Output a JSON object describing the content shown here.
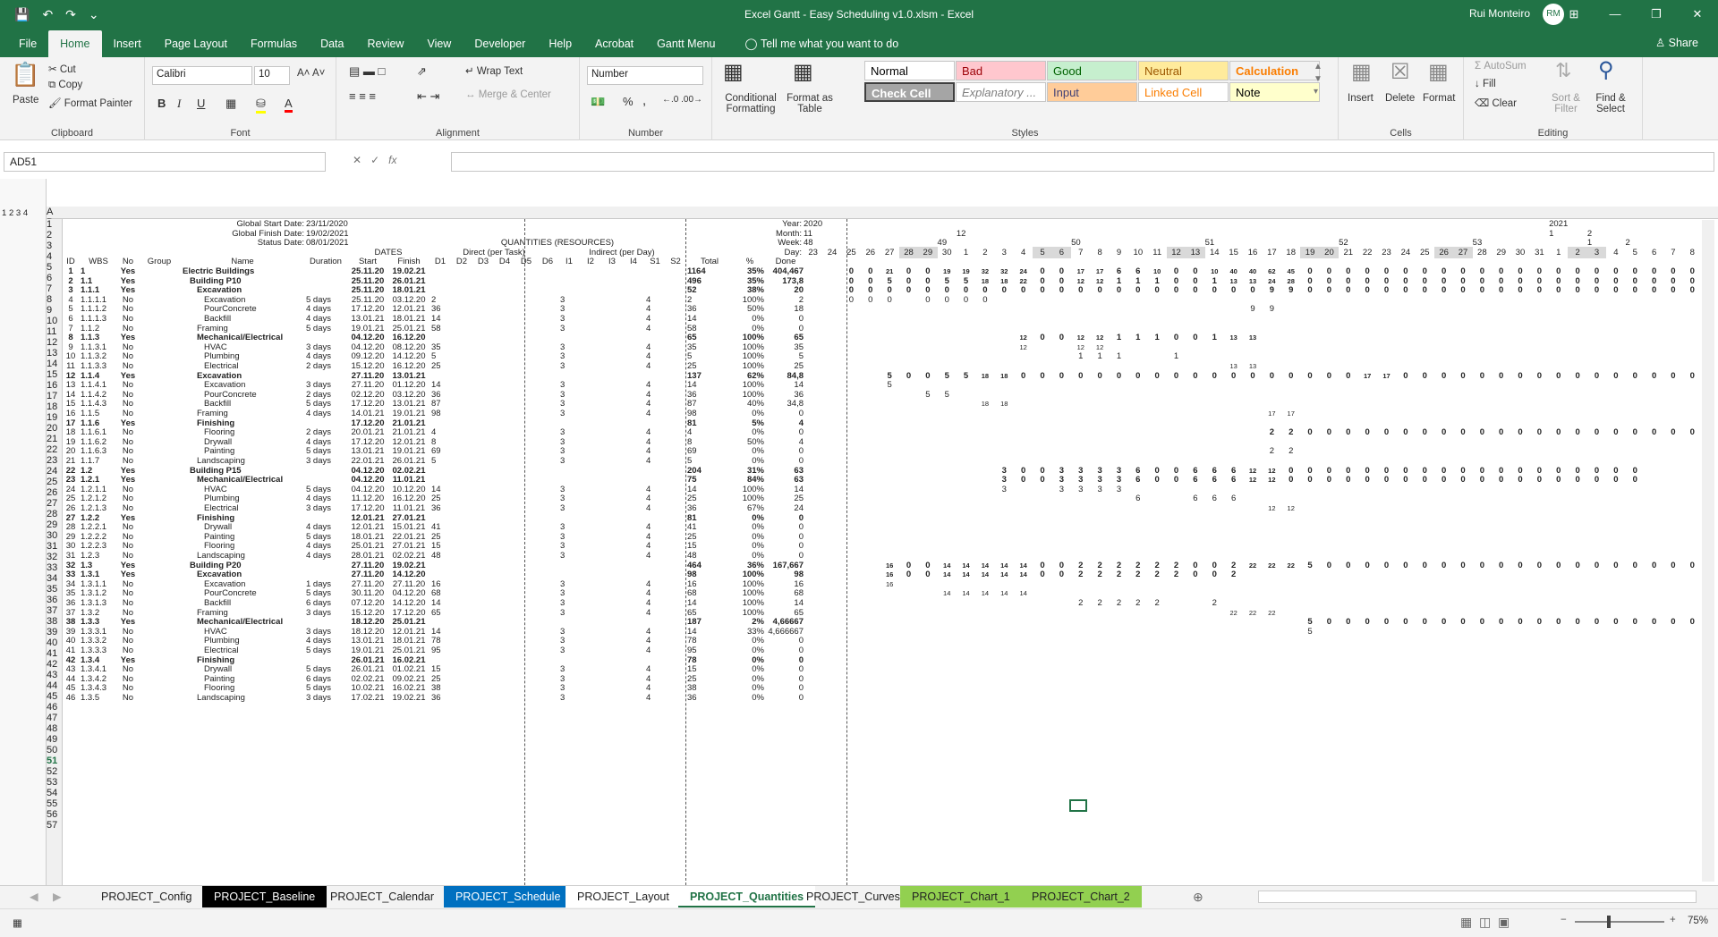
{
  "app": {
    "title": "Excel Gantt - Easy Scheduling v1.0.xlsm  -  Excel",
    "user": "Rui Monteiro",
    "user_initials": "RM",
    "share": "Share",
    "win_min": "—",
    "win_max": "❐",
    "win_close": "✕",
    "ribbon_display": "⊞"
  },
  "ribbon_tabs": [
    "File",
    "Home",
    "Insert",
    "Page Layout",
    "Formulas",
    "Data",
    "Review",
    "View",
    "Developer",
    "Help",
    "Acrobat",
    "Gantt Menu"
  ],
  "tell_me": "Tell me what you want to do",
  "clipboard": {
    "paste": "Paste",
    "cut": "Cut",
    "copy": "Copy",
    "format_painter": "Format Painter",
    "label": "Clipboard"
  },
  "font": {
    "name": "Calibri",
    "size": "10",
    "label": "Font",
    "bold": "B",
    "italic": "I",
    "underline": "U"
  },
  "alignment": {
    "wrap": "Wrap Text",
    "merge": "Merge & Center",
    "label": "Alignment"
  },
  "number": {
    "format": "Number",
    "label": "Number",
    "percent": "%",
    "comma": ","
  },
  "styles": {
    "conditional": "Conditional Formatting",
    "format_table": "Format as Table",
    "label": "Styles",
    "items": [
      {
        "name": "Normal",
        "bg": "#ffffff",
        "fg": "#000000"
      },
      {
        "name": "Bad",
        "bg": "#ffc7ce",
        "fg": "#9c0006"
      },
      {
        "name": "Good",
        "bg": "#c6efce",
        "fg": "#006100"
      },
      {
        "name": "Neutral",
        "bg": "#ffeb9c",
        "fg": "#9c5700"
      },
      {
        "name": "Calculation",
        "bg": "#f2f2f2",
        "fg": "#fa7d00"
      },
      {
        "name": "Check Cell",
        "bg": "#a5a5a5",
        "fg": "#ffffff"
      },
      {
        "name": "Explanatory ...",
        "bg": "#ffffff",
        "fg": "#7f7f7f"
      },
      {
        "name": "Input",
        "bg": "#ffcc99",
        "fg": "#3f3f76"
      },
      {
        "name": "Linked Cell",
        "bg": "#ffffff",
        "fg": "#fa7d00"
      },
      {
        "name": "Note",
        "bg": "#ffffcc",
        "fg": "#000000"
      }
    ]
  },
  "cells": {
    "insert": "Insert",
    "delete": "Delete",
    "format": "Format",
    "label": "Cells"
  },
  "editing": {
    "autosum": "AutoSum",
    "fill": "Fill",
    "clear": "Clear",
    "sort": "Sort & Filter",
    "find": "Find & Select",
    "label": "Editing"
  },
  "formula_bar": {
    "name_box": "AD51",
    "fx": "fx",
    "value": ""
  },
  "header_info": {
    "start_label": "Global Start Date:",
    "start": "23/11/2020",
    "finish_label": "Global Finish Date:",
    "finish": "19/02/2021",
    "status_label": "Status Date:",
    "status": "08/01/2021",
    "dates": "DATES",
    "quantities": "QUANTITIES (RESOURCES)",
    "direct": "Direct (per Task)",
    "indirect": "Indirect (per Day)"
  },
  "gantt_labels": {
    "year": "Year:",
    "month": "Month:",
    "week": "Week:",
    "day": "Day:"
  },
  "years": [
    "2020",
    "2021"
  ],
  "months": [
    "11",
    "12",
    "1",
    "2"
  ],
  "weeks": [
    "48",
    "49",
    "50",
    "51",
    "52",
    "53",
    "1",
    "2"
  ],
  "days": [
    "23",
    "24",
    "25",
    "26",
    "27",
    "28",
    "29",
    "30",
    "1",
    "2",
    "3",
    "4",
    "5",
    "6",
    "7",
    "8",
    "9",
    "10",
    "11",
    "12",
    "13",
    "14",
    "15",
    "16",
    "17",
    "18",
    "19",
    "20",
    "21",
    "22",
    "23",
    "24",
    "25",
    "26",
    "27",
    "28",
    "29",
    "30",
    "31",
    "1",
    "2",
    "3",
    "4",
    "5",
    "6",
    "7",
    "8"
  ],
  "col_letters": [
    "A",
    "B",
    "C",
    "D",
    "E",
    "F",
    "G",
    "H",
    "I",
    "J",
    "K",
    "L",
    "M",
    "N",
    "O",
    "P",
    "Q",
    "R",
    "S",
    "T",
    "U",
    "V",
    "W",
    "X",
    "Y",
    "Z",
    "AA",
    "AB",
    "AC",
    "AD",
    "AE",
    "AF",
    "AG",
    "AH",
    "AI",
    "AJ",
    "AK",
    "AL",
    "AM",
    "AN",
    "AO",
    "AP",
    "AQ",
    "AR",
    "AS",
    "AT",
    "AU",
    "AV",
    "AW",
    "AX",
    "AY",
    "AZ",
    "BA",
    "BB",
    "BC",
    "BD",
    "BE",
    "BF",
    "BG",
    "BH",
    "BI",
    "BJ",
    "BK",
    "BL",
    "BM",
    "BN",
    "BO",
    "BP",
    "BQ",
    "BR"
  ],
  "col_headers": [
    "ID",
    "WBS",
    "No",
    "Group",
    "Name",
    "Duration",
    "Start",
    "Finish",
    "D1",
    "D2",
    "D3",
    "D4",
    "D5",
    "D6",
    "I1",
    "I2",
    "I3",
    "I4",
    "S1",
    "S2",
    "Total",
    "%",
    "Done"
  ],
  "outline_levels": [
    "1",
    "2",
    "3",
    "4"
  ],
  "rows": [
    [
      "1",
      "1",
      "Yes",
      "Electric Buildings",
      "",
      "25.11.20",
      "19.02.21",
      "",
      "1164",
      "35%",
      "404,467"
    ],
    [
      "2",
      "1.1",
      "Yes",
      "Building P10",
      "",
      "25.11.20",
      "26.01.21",
      "",
      "496",
      "35%",
      "173,8"
    ],
    [
      "3",
      "1.1.1",
      "Yes",
      "Excavation",
      "",
      "25.11.20",
      "18.01.21",
      "",
      "52",
      "38%",
      "20"
    ],
    [
      "4",
      "1.1.1.1",
      "No",
      "Excavation",
      "5 days",
      "25.11.20",
      "03.12.20",
      "2",
      "2",
      "100%",
      "2"
    ],
    [
      "5",
      "1.1.1.2",
      "No",
      "PourConcrete",
      "4 days",
      "17.12.20",
      "12.01.21",
      "36",
      "36",
      "50%",
      "18"
    ],
    [
      "6",
      "1.1.1.3",
      "No",
      "Backfill",
      "4 days",
      "13.01.21",
      "18.01.21",
      "14",
      "14",
      "0%",
      "0"
    ],
    [
      "7",
      "1.1.2",
      "No",
      "Framing",
      "5 days",
      "19.01.21",
      "25.01.21",
      "58",
      "58",
      "0%",
      "0"
    ],
    [
      "8",
      "1.1.3",
      "Yes",
      "Mechanical/Electrical",
      "",
      "04.12.20",
      "16.12.20",
      "",
      "65",
      "100%",
      "65"
    ],
    [
      "9",
      "1.1.3.1",
      "No",
      "HVAC",
      "3 days",
      "04.12.20",
      "08.12.20",
      "35",
      "35",
      "100%",
      "35"
    ],
    [
      "10",
      "1.1.3.2",
      "No",
      "Plumbing",
      "4 days",
      "09.12.20",
      "14.12.20",
      "5",
      "5",
      "100%",
      "5"
    ],
    [
      "11",
      "1.1.3.3",
      "No",
      "Electrical",
      "2 days",
      "15.12.20",
      "16.12.20",
      "25",
      "25",
      "100%",
      "25"
    ],
    [
      "12",
      "1.1.4",
      "Yes",
      "Excavation",
      "",
      "27.11.20",
      "13.01.21",
      "",
      "137",
      "62%",
      "84,8"
    ],
    [
      "13",
      "1.1.4.1",
      "No",
      "Excavation",
      "3 days",
      "27.11.20",
      "01.12.20",
      "14",
      "14",
      "100%",
      "14"
    ],
    [
      "14",
      "1.1.4.2",
      "No",
      "PourConcrete",
      "2 days",
      "02.12.20",
      "03.12.20",
      "36",
      "36",
      "100%",
      "36"
    ],
    [
      "15",
      "1.1.4.3",
      "No",
      "Backfill",
      "5 days",
      "17.12.20",
      "13.01.21",
      "87",
      "87",
      "40%",
      "34,8"
    ],
    [
      "16",
      "1.1.5",
      "No",
      "Framing",
      "4 days",
      "14.01.21",
      "19.01.21",
      "98",
      "98",
      "0%",
      "0"
    ],
    [
      "17",
      "1.1.6",
      "Yes",
      "Finishing",
      "",
      "17.12.20",
      "21.01.21",
      "",
      "81",
      "5%",
      "4"
    ],
    [
      "18",
      "1.1.6.1",
      "No",
      "Flooring",
      "2 days",
      "20.01.21",
      "21.01.21",
      "4",
      "4",
      "0%",
      "0"
    ],
    [
      "19",
      "1.1.6.2",
      "No",
      "Drywall",
      "4 days",
      "17.12.20",
      "12.01.21",
      "8",
      "8",
      "50%",
      "4"
    ],
    [
      "20",
      "1.1.6.3",
      "No",
      "Painting",
      "5 days",
      "13.01.21",
      "19.01.21",
      "69",
      "69",
      "0%",
      "0"
    ],
    [
      "21",
      "1.1.7",
      "No",
      "Landscaping",
      "3 days",
      "22.01.21",
      "26.01.21",
      "5",
      "5",
      "0%",
      "0"
    ],
    [
      "22",
      "1.2",
      "Yes",
      "Building P15",
      "",
      "04.12.20",
      "02.02.21",
      "",
      "204",
      "31%",
      "63"
    ],
    [
      "23",
      "1.2.1",
      "Yes",
      "Mechanical/Electrical",
      "",
      "04.12.20",
      "11.01.21",
      "",
      "75",
      "84%",
      "63"
    ],
    [
      "24",
      "1.2.1.1",
      "No",
      "HVAC",
      "5 days",
      "04.12.20",
      "10.12.20",
      "14",
      "14",
      "100%",
      "14"
    ],
    [
      "25",
      "1.2.1.2",
      "No",
      "Plumbing",
      "4 days",
      "11.12.20",
      "16.12.20",
      "25",
      "25",
      "100%",
      "25"
    ],
    [
      "26",
      "1.2.1.3",
      "No",
      "Electrical",
      "3 days",
      "17.12.20",
      "11.01.21",
      "36",
      "36",
      "67%",
      "24"
    ],
    [
      "27",
      "1.2.2",
      "Yes",
      "Finishing",
      "",
      "12.01.21",
      "27.01.21",
      "",
      "81",
      "0%",
      "0"
    ],
    [
      "28",
      "1.2.2.1",
      "No",
      "Drywall",
      "4 days",
      "12.01.21",
      "15.01.21",
      "41",
      "41",
      "0%",
      "0"
    ],
    [
      "29",
      "1.2.2.2",
      "No",
      "Painting",
      "5 days",
      "18.01.21",
      "22.01.21",
      "25",
      "25",
      "0%",
      "0"
    ],
    [
      "30",
      "1.2.2.3",
      "No",
      "Flooring",
      "4 days",
      "25.01.21",
      "27.01.21",
      "15",
      "15",
      "0%",
      "0"
    ],
    [
      "31",
      "1.2.3",
      "No",
      "Landscaping",
      "4 days",
      "28.01.21",
      "02.02.21",
      "48",
      "48",
      "0%",
      "0"
    ],
    [
      "32",
      "1.3",
      "Yes",
      "Building P20",
      "",
      "27.11.20",
      "19.02.21",
      "",
      "464",
      "36%",
      "167,667"
    ],
    [
      "33",
      "1.3.1",
      "Yes",
      "Excavation",
      "",
      "27.11.20",
      "14.12.20",
      "",
      "98",
      "100%",
      "98"
    ],
    [
      "34",
      "1.3.1.1",
      "No",
      "Excavation",
      "1 days",
      "27.11.20",
      "27.11.20",
      "16",
      "16",
      "100%",
      "16"
    ],
    [
      "35",
      "1.3.1.2",
      "No",
      "PourConcrete",
      "5 days",
      "30.11.20",
      "04.12.20",
      "68",
      "68",
      "100%",
      "68"
    ],
    [
      "36",
      "1.3.1.3",
      "No",
      "Backfill",
      "6 days",
      "07.12.20",
      "14.12.20",
      "14",
      "14",
      "100%",
      "14"
    ],
    [
      "37",
      "1.3.2",
      "No",
      "Framing",
      "3 days",
      "15.12.20",
      "17.12.20",
      "65",
      "65",
      "100%",
      "65"
    ],
    [
      "38",
      "1.3.3",
      "Yes",
      "Mechanical/Electrical",
      "",
      "18.12.20",
      "25.01.21",
      "",
      "187",
      "2%",
      "4,66667"
    ],
    [
      "39",
      "1.3.3.1",
      "No",
      "HVAC",
      "3 days",
      "18.12.20",
      "12.01.21",
      "14",
      "14",
      "33%",
      "4,666667"
    ],
    [
      "40",
      "1.3.3.2",
      "No",
      "Plumbing",
      "4 days",
      "13.01.21",
      "18.01.21",
      "78",
      "78",
      "0%",
      "0"
    ],
    [
      "41",
      "1.3.3.3",
      "No",
      "Electrical",
      "5 days",
      "19.01.21",
      "25.01.21",
      "95",
      "95",
      "0%",
      "0"
    ],
    [
      "42",
      "1.3.4",
      "Yes",
      "Finishing",
      "",
      "26.01.21",
      "16.02.21",
      "",
      "78",
      "0%",
      "0"
    ],
    [
      "43",
      "1.3.4.1",
      "No",
      "Drywall",
      "5 days",
      "26.01.21",
      "01.02.21",
      "15",
      "15",
      "0%",
      "0"
    ],
    [
      "44",
      "1.3.4.2",
      "No",
      "Painting",
      "6 days",
      "02.02.21",
      "09.02.21",
      "25",
      "25",
      "0%",
      "0"
    ],
    [
      "45",
      "1.3.4.3",
      "No",
      "Flooring",
      "5 days",
      "10.02.21",
      "16.02.21",
      "38",
      "38",
      "0%",
      "0"
    ],
    [
      "46",
      "1.3.5",
      "No",
      "Landscaping",
      "3 days",
      "17.02.21",
      "19.02.21",
      "36",
      "36",
      "0%",
      "0"
    ]
  ],
  "indirect": {
    "i1": "3",
    "s1": "4"
  },
  "gantt_rows": {
    "6": [
      "0",
      "0",
      "21",
      "0",
      "0",
      "19",
      "19",
      "32",
      "32",
      "24",
      "0",
      "0",
      "17",
      "17",
      "6",
      "6",
      "10",
      "0",
      "0",
      "10",
      "40",
      "40",
      "62",
      "45",
      "0",
      "0",
      "0",
      "0",
      "0",
      "0",
      "0",
      "0",
      "0",
      "0",
      "0",
      "0",
      "0",
      "0",
      "0",
      "0",
      "0",
      "0",
      "0",
      "0",
      "0",
      "0",
      "0",
      "0"
    ],
    "7": [
      "0",
      "0",
      "5",
      "0",
      "0",
      "5",
      "5",
      "18",
      "18",
      "22",
      "0",
      "0",
      "12",
      "12",
      "1",
      "1",
      "1",
      "0",
      "0",
      "1",
      "13",
      "13",
      "24",
      "28",
      "0",
      "0",
      "0",
      "0",
      "0",
      "0",
      "0",
      "0",
      "0",
      "0",
      "0",
      "0",
      "0",
      "0",
      "0",
      "0",
      "0",
      "0",
      "0",
      "0",
      "0",
      "0",
      "0",
      "0"
    ],
    "8": [
      "0",
      "0",
      "0",
      "0",
      "0",
      "0",
      "0",
      "0",
      "0",
      "0",
      "0",
      "0",
      "0",
      "0",
      "0",
      "0",
      "0",
      "0",
      "0",
      "0",
      "0",
      "0",
      "9",
      "9",
      "0",
      "0",
      "0",
      "0",
      "0",
      "0",
      "0",
      "0",
      "0",
      "0",
      "0",
      "0",
      "0",
      "0",
      "0",
      "0",
      "0",
      "0",
      "0",
      "0",
      "0",
      "0",
      "0",
      "0"
    ],
    "9": [
      "0",
      "0",
      "0",
      "",
      "0",
      "0",
      "0",
      "0"
    ],
    "10": [
      "9",
      "9"
    ],
    "13": [
      "12",
      "0",
      "0",
      "12",
      "12",
      "1",
      "1",
      "1",
      "0",
      "0",
      "1",
      "13",
      "13"
    ],
    "14": [
      "12",
      "",
      "",
      "12",
      "12"
    ],
    "15": [
      "1",
      "1",
      "1",
      "",
      "",
      "1"
    ],
    "16": [
      "13",
      "13"
    ],
    "17": [
      "5",
      "0",
      "0",
      "5",
      "5",
      "18",
      "18",
      "0",
      "0",
      "0",
      "0",
      "0",
      "0",
      "0",
      "0",
      "0",
      "0",
      "0",
      "0",
      "0",
      "0",
      "0",
      "0",
      "0",
      "0",
      "17",
      "17",
      "0",
      "0",
      "0",
      "0",
      "0",
      "0",
      "0",
      "0",
      "0",
      "0",
      "0",
      "0",
      "0",
      "0",
      "0",
      "0",
      "0",
      "0",
      "0",
      "0",
      "0"
    ],
    "18": [
      "5"
    ],
    "19": [
      "5",
      "5"
    ],
    "20": [
      "18",
      "18"
    ],
    "21": [
      "17",
      "17"
    ],
    "23": [
      "2",
      "2",
      "0",
      "0",
      "0",
      "0",
      "0",
      "0",
      "0",
      "0",
      "0",
      "0",
      "0",
      "0",
      "0",
      "0",
      "0",
      "0",
      "0",
      "0",
      "0",
      "0",
      "0",
      "0",
      "0"
    ],
    "25": [
      "2",
      "2"
    ],
    "27": [
      "3",
      "0",
      "0",
      "3",
      "3",
      "3",
      "3",
      "6",
      "0",
      "0",
      "6",
      "6",
      "6",
      "12",
      "12",
      "0",
      "0",
      "0",
      "0",
      "0",
      "0",
      "0",
      "0",
      "0",
      "0",
      "0",
      "0",
      "0",
      "0",
      "0",
      "0",
      "0",
      "0",
      "0"
    ],
    "28": [
      "3",
      "0",
      "0",
      "3",
      "3",
      "3",
      "3",
      "6",
      "0",
      "0",
      "6",
      "6",
      "6",
      "12",
      "12",
      "0",
      "0",
      "0",
      "0",
      "0",
      "0",
      "0",
      "0",
      "0",
      "0",
      "0",
      "0",
      "0",
      "0",
      "0",
      "0",
      "0",
      "0",
      "0"
    ],
    "29": [
      "3",
      "",
      "",
      "3",
      "3",
      "3",
      "3"
    ],
    "30": [
      "6",
      "",
      "",
      "6",
      "6",
      "6"
    ],
    "31": [
      "12",
      "12"
    ],
    "37": [
      "16",
      "0",
      "0",
      "14",
      "14",
      "14",
      "14",
      "14",
      "0",
      "0",
      "2",
      "2",
      "2",
      "2",
      "2",
      "2",
      "0",
      "0",
      "2",
      "22",
      "22",
      "22",
      "5",
      "0",
      "0",
      "0",
      "0",
      "0",
      "0",
      "0",
      "0",
      "0",
      "0",
      "0",
      "0",
      "0",
      "0",
      "0",
      "0",
      "0",
      "0",
      "0",
      "0",
      "0",
      "0"
    ],
    "38": [
      "16",
      "0",
      "0",
      "14",
      "14",
      "14",
      "14",
      "14",
      "0",
      "0",
      "2",
      "2",
      "2",
      "2",
      "2",
      "2",
      "0",
      "0",
      "2"
    ],
    "39": [
      "16"
    ],
    "40": [
      "14",
      "14",
      "14",
      "14",
      "14"
    ],
    "41": [
      "2",
      "2",
      "2",
      "2",
      "2",
      "",
      "",
      "2"
    ],
    "42": [
      "22",
      "22",
      "22"
    ],
    "43": [
      "5",
      "0",
      "0",
      "0",
      "0",
      "0",
      "0",
      "0",
      "0",
      "0",
      "0",
      "0",
      "0",
      "0",
      "0",
      "0",
      "0",
      "0",
      "0",
      "0",
      "0",
      "0",
      "0",
      "0"
    ],
    "44": [
      "5"
    ]
  },
  "sheets": [
    "PROJECT_Config",
    "PROJECT_Baseline",
    "PROJECT_Calendar",
    "PROJECT_Schedule",
    "PROJECT_Layout",
    "PROJECT_Quantities",
    "PROJECT_Curves",
    "PROJECT_Chart_1",
    "PROJECT_Chart_2"
  ],
  "active_sheet": "PROJECT_Quantities",
  "zoom": "75%",
  "colors": {
    "accent": "#217346"
  }
}
